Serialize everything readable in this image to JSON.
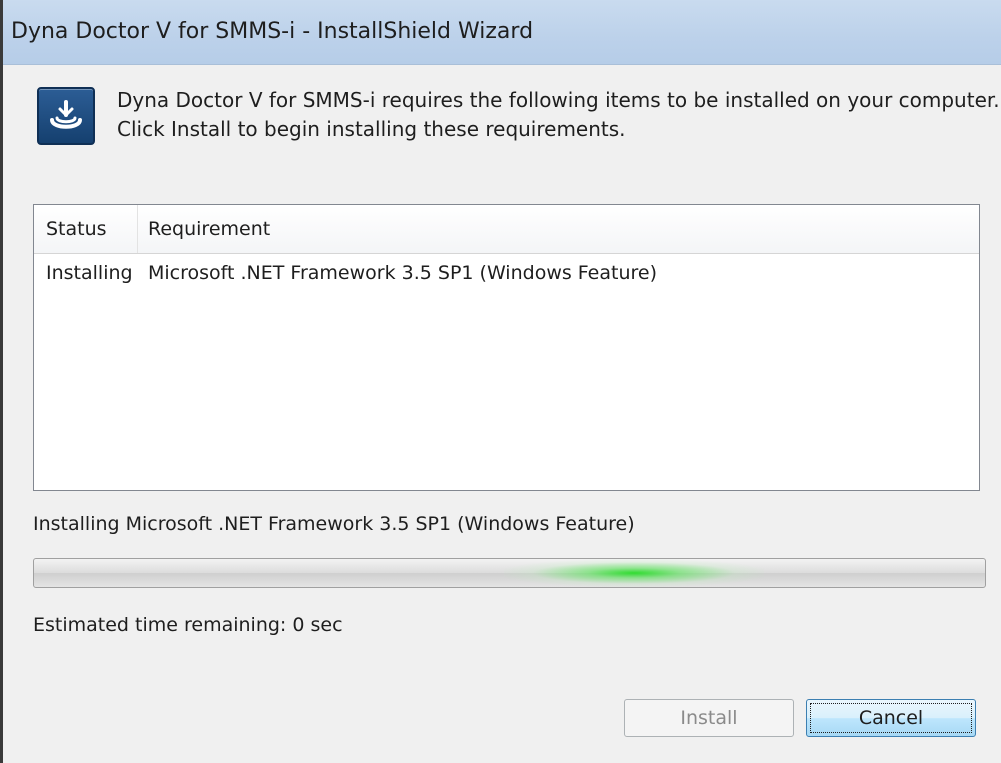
{
  "window": {
    "title": "Dyna Doctor V for SMMS-i - InstallShield Wizard"
  },
  "intro": {
    "line1": "Dyna Doctor V for SMMS-i requires the following items to be installed on your computer.",
    "line2": "Click Install to begin installing these requirements."
  },
  "table": {
    "headers": {
      "status": "Status",
      "requirement": "Requirement"
    },
    "rows": [
      {
        "status": "Installing",
        "requirement": "Microsoft .NET Framework 3.5 SP1 (Windows Feature)"
      }
    ]
  },
  "progress": {
    "status_text": "Installing Microsoft .NET Framework 3.5 SP1 (Windows Feature)",
    "indeterminate": true,
    "accent_color": "#22dd22"
  },
  "time_remaining": "Estimated time remaining:  0 sec",
  "buttons": {
    "install_label": "Install",
    "install_enabled": false,
    "cancel_label": "Cancel"
  },
  "icons": {
    "app_icon": "installshield-app-icon"
  }
}
